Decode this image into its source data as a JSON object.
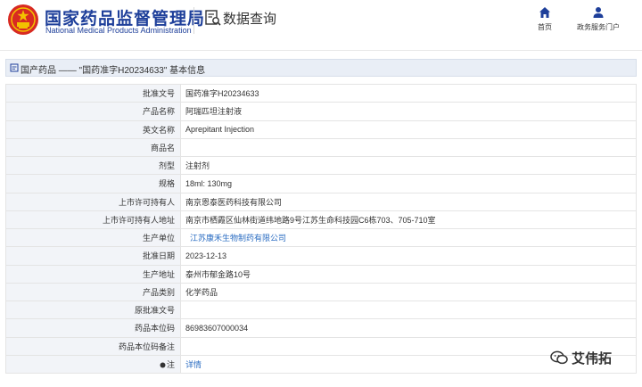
{
  "header": {
    "agency_name": "国家药品监督管理局",
    "agency_name_en": "National Medical Products Administration",
    "section_label": "数据查询",
    "nav": [
      {
        "label": "首页",
        "icon": "home-icon"
      },
      {
        "label": "政务服务门户",
        "icon": "user-icon"
      }
    ]
  },
  "title_bar": {
    "text": "国产药品 —— \"国药准字H20234633\" 基本信息"
  },
  "rows": [
    {
      "key": "批准文号",
      "value": "国药准字H20234633"
    },
    {
      "key": "产品名称",
      "value": "阿瑞匹坦注射液"
    },
    {
      "key": "英文名称",
      "value": "Aprepitant Injection"
    },
    {
      "key": "商品名",
      "value": ""
    },
    {
      "key": "剂型",
      "value": "注射剂"
    },
    {
      "key": "规格",
      "value": "18ml: 130mg"
    },
    {
      "key": "上市许可持有人",
      "value": "南京恩泰医药科技有限公司"
    },
    {
      "key": "上市许可持有人地址",
      "value": "南京市栖霞区仙林街道纬地路9号江苏生命科技园C6栋703、705-710室"
    },
    {
      "key": "生产单位",
      "value": "江苏康禾生物制药有限公司"
    },
    {
      "key": "批准日期",
      "value": "2023-12-13"
    },
    {
      "key": "生产地址",
      "value": "泰州市郁金路10号"
    },
    {
      "key": "产品类别",
      "value": "化学药品"
    },
    {
      "key": "原批准文号",
      "value": ""
    },
    {
      "key": "药品本位码",
      "value": "86983607000034"
    },
    {
      "key": "药品本位码备注",
      "value": ""
    },
    {
      "key": "注",
      "value": "详情"
    }
  ],
  "watermark": {
    "text": "艾伟拓",
    "icon": "wechat-icon"
  },
  "colors": {
    "brand_blue": "#1e3f9a",
    "link_blue": "#2a6cc2",
    "key_bg": "#f2f4f8",
    "title_bar_bg": "#e9eef6"
  }
}
